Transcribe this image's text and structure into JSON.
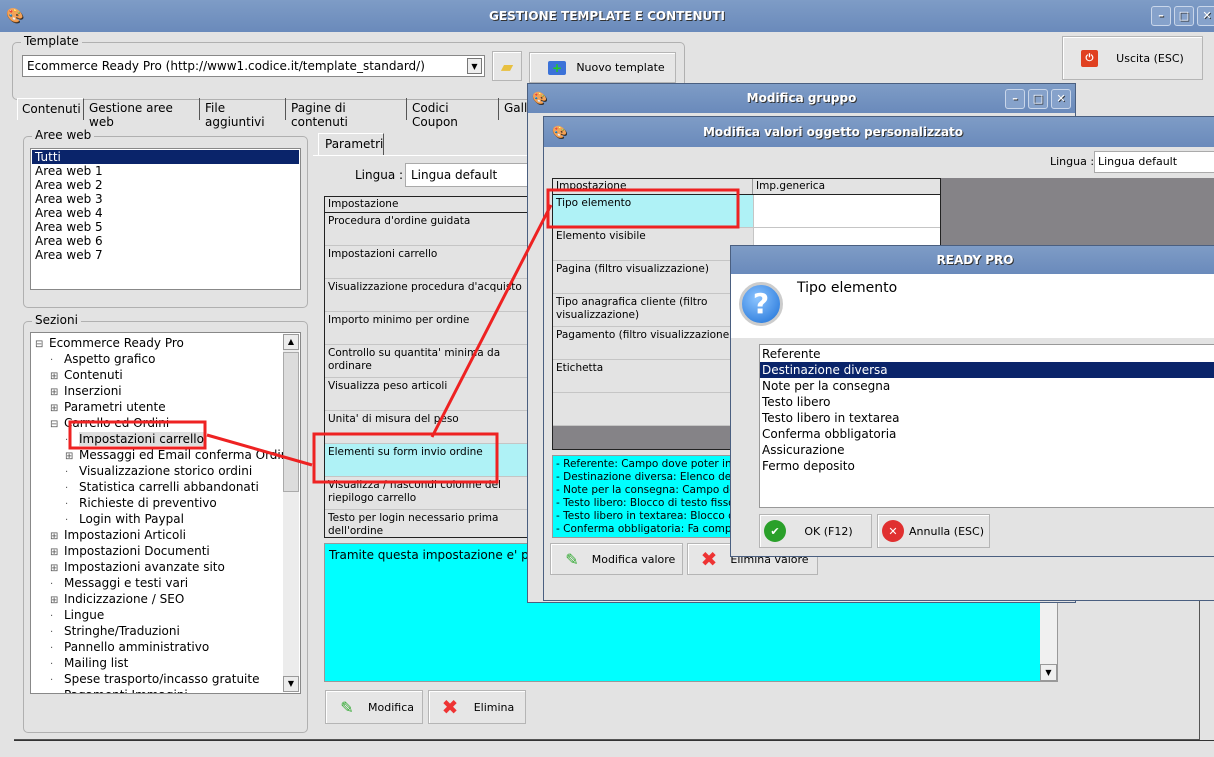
{
  "main_window": {
    "title": "GESTIONE TEMPLATE E CONTENUTI"
  },
  "template": {
    "legend": "Template",
    "value": "Ecommerce Ready Pro (http://www1.codice.it/template_standard/)",
    "new_label": "Nuovo template"
  },
  "exit_label": "Uscita (ESC)",
  "tabs": [
    "Contenuti",
    "Gestione aree web",
    "File aggiuntivi",
    "Pagine di contenuti",
    "Codici Coupon",
    "Galle"
  ],
  "aree_web": {
    "legend": "Aree web",
    "items": [
      "Tutti",
      "Area web 1",
      "Area web 2",
      "Area web 3",
      "Area web 4",
      "Area web 5",
      "Area web 6",
      "Area web 7"
    ]
  },
  "sezioni": {
    "legend": "Sezioni",
    "items": [
      "Ecommerce Ready Pro",
      "Aspetto grafico",
      "Contenuti",
      "Inserzioni",
      "Parametri utente",
      "Carrello ed Ordini",
      "Impostazioni carrello",
      "Messaggi ed Email conferma Ordine",
      "Visualizzazione storico ordini",
      "Statistica carrelli abbandonati",
      "Richieste di preventivo",
      "Login with Paypal",
      "Impostazioni Articoli",
      "Impostazioni Documenti",
      "Impostazioni avanzate sito",
      "Messaggi e testi vari",
      "Indicizzazione / SEO",
      "Lingue",
      "Stringhe/Traduzioni",
      "Pannello amministrativo",
      "Mailing list",
      "Spese trasporto/incasso gratuite",
      "Pagamenti Immagini"
    ]
  },
  "parametri": {
    "tab": "Parametri",
    "lingua_label": "Lingua :",
    "lingua_value": "Lingua default",
    "header": "Impostazione",
    "rows": [
      "Procedura d'ordine guidata",
      "Impostazioni carrello",
      "Visualizzazione procedura d'acquisto",
      "Importo minimo per ordine",
      "Controllo su quantita' minima da ordinare",
      "Visualizza peso articoli",
      "Unita' di misura del peso",
      "Elementi su form invio ordine",
      "Visualizza / nascondi colonne del riepilogo carrello",
      "Testo per login necessario prima dell'ordine"
    ],
    "description": "Tramite questa impostazione e' possi",
    "modify": "Modifica",
    "delete": "Elimina"
  },
  "modifica_gruppo": {
    "title": "Modifica gruppo"
  },
  "modifica_valori": {
    "title": "Modifica valori oggetto personalizzato",
    "lingua_label": "Lingua :",
    "lingua_value": "Lingua default",
    "col1": "Impostazione",
    "col2": "Imp.generica",
    "rows": [
      "Tipo elemento",
      "Elemento visibile",
      "Pagina (filtro visualizzazione)",
      "Tipo anagrafica cliente (filtro visualizzazione)",
      "Pagamento (filtro visualizzazione)",
      "Etichetta"
    ],
    "description": [
      "- Referente: Campo dove poter indic",
      "- Destinazione diversa: Elenco destin",
      "- Note per la consegna: Campo dove",
      "- Testo libero: Blocco di testo fisso",
      "- Testo libero in textarea: Blocco di te",
      "- Conferma obbligatoria: Fa comparir"
    ],
    "modify": "Modifica valore",
    "delete": "Elimina valore"
  },
  "ready_pro": {
    "title": "READY PRO",
    "question": "Tipo elemento",
    "options": [
      "Referente",
      "Destinazione diversa",
      "Note per la consegna",
      "Testo libero",
      "Testo libero in textarea",
      "Conferma obbligatoria",
      "Assicurazione",
      "Fermo deposito"
    ],
    "selected": 1,
    "ok": "OK (F12)",
    "cancel": "Annulla (ESC)"
  }
}
